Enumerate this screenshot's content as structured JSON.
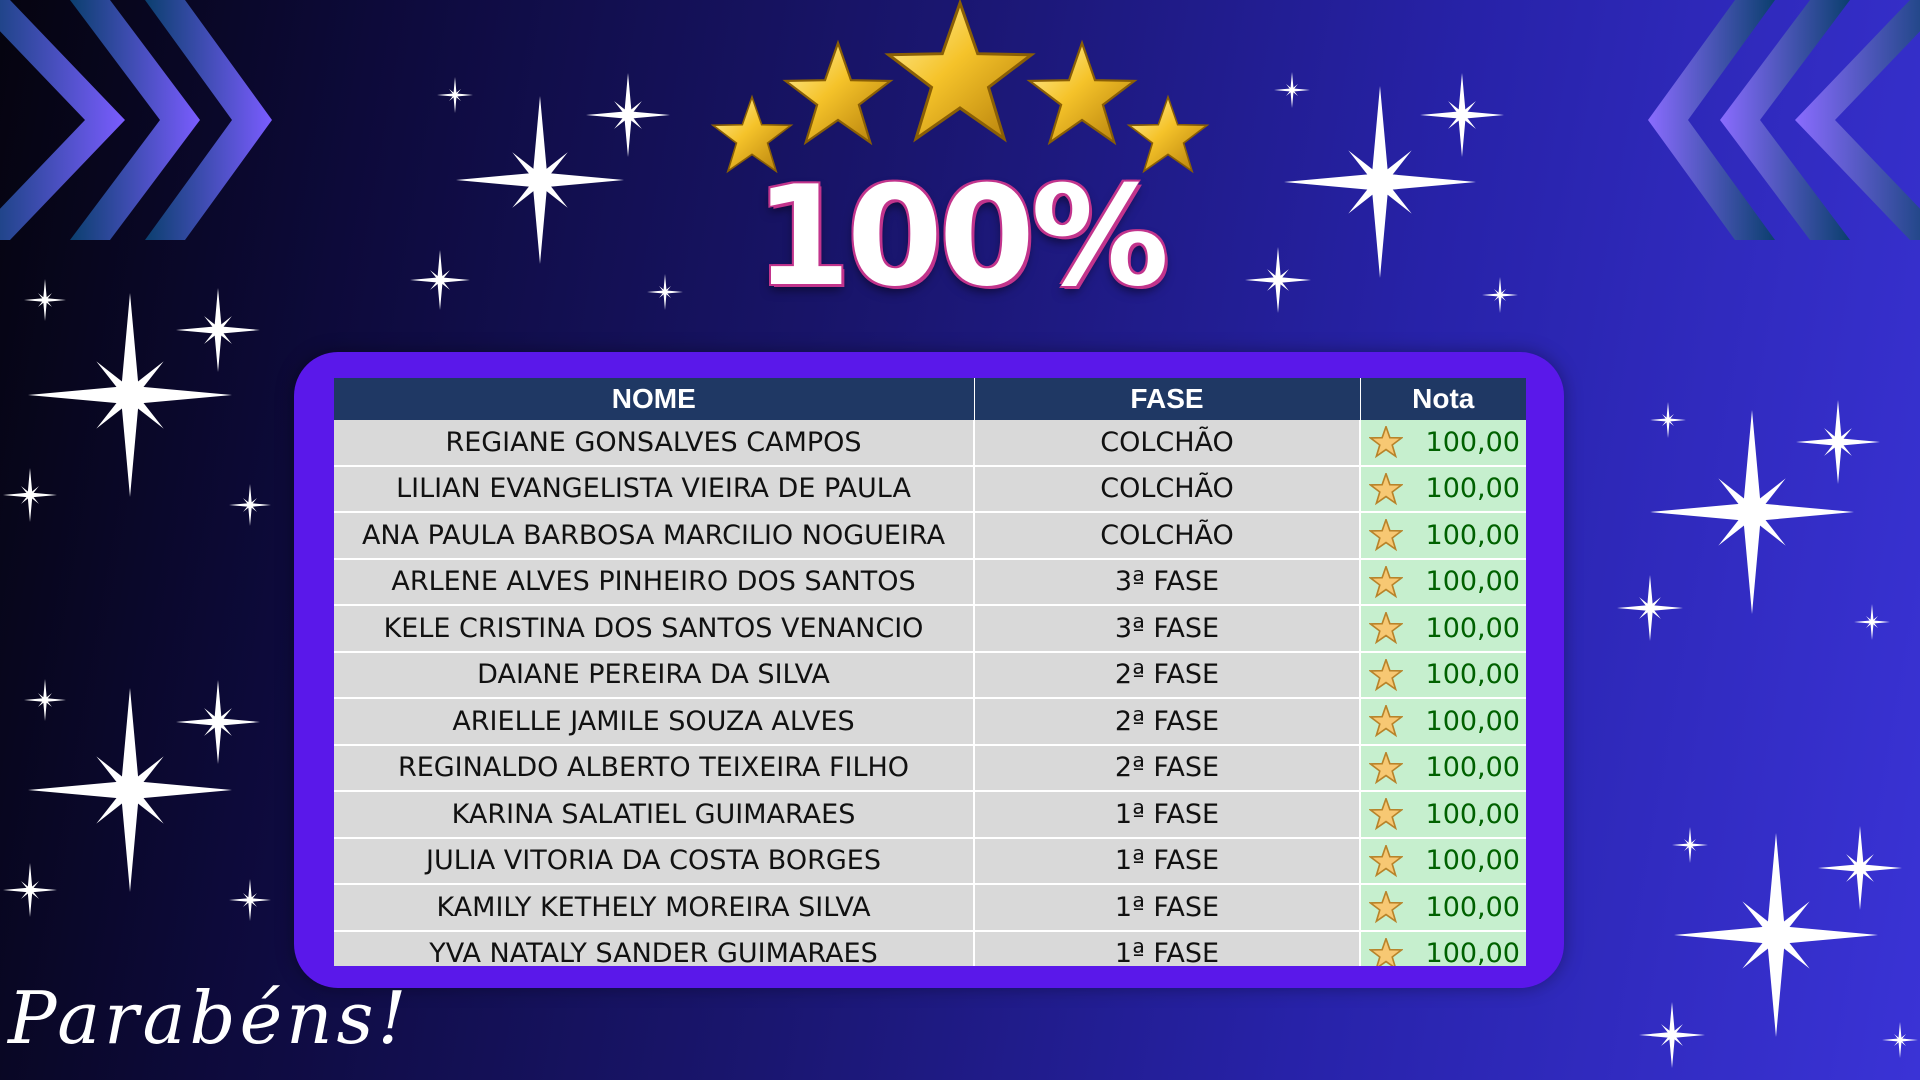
{
  "headline": "100%",
  "footer_text": "Parabéns!",
  "decorations": {
    "top_stars": "gold-star-icon",
    "sparkles": "sparkle-icon",
    "chevrons": "chevron-icon"
  },
  "colors": {
    "frame": "#5a18ea",
    "header": "#1f3864",
    "row": "#d9d9d9",
    "nota_bg": "#c6efce",
    "nota_text": "#006100",
    "gold": "#f5c32a"
  },
  "table": {
    "columns": [
      "NOME",
      "FASE",
      "Nota"
    ],
    "rows": [
      {
        "nome": "REGIANE GONSALVES CAMPOS",
        "fase": "COLCHÃO",
        "nota": "100,00"
      },
      {
        "nome": "LILIAN EVANGELISTA VIEIRA DE PAULA",
        "fase": "COLCHÃO",
        "nota": "100,00"
      },
      {
        "nome": "ANA PAULA  BARBOSA MARCILIO NOGUEIRA",
        "fase": "COLCHÃO",
        "nota": "100,00"
      },
      {
        "nome": "ARLENE ALVES PINHEIRO DOS SANTOS",
        "fase": "3ª FASE",
        "nota": "100,00"
      },
      {
        "nome": "KELE CRISTINA DOS SANTOS VENANCIO",
        "fase": "3ª FASE",
        "nota": "100,00"
      },
      {
        "nome": "DAIANE PEREIRA DA SILVA",
        "fase": "2ª FASE",
        "nota": "100,00"
      },
      {
        "nome": "ARIELLE JAMILE SOUZA ALVES",
        "fase": "2ª FASE",
        "nota": "100,00"
      },
      {
        "nome": "REGINALDO ALBERTO TEIXEIRA FILHO",
        "fase": "2ª FASE",
        "nota": "100,00"
      },
      {
        "nome": "KARINA SALATIEL GUIMARAES",
        "fase": "1ª FASE",
        "nota": "100,00"
      },
      {
        "nome": "JULIA VITORIA DA COSTA BORGES",
        "fase": "1ª FASE",
        "nota": "100,00"
      },
      {
        "nome": "KAMILY KETHELY MOREIRA SILVA",
        "fase": "1ª FASE",
        "nota": "100,00"
      },
      {
        "nome": "YVA NATALY SANDER GUIMARAES",
        "fase": "1ª FASE",
        "nota": "100,00"
      }
    ]
  }
}
